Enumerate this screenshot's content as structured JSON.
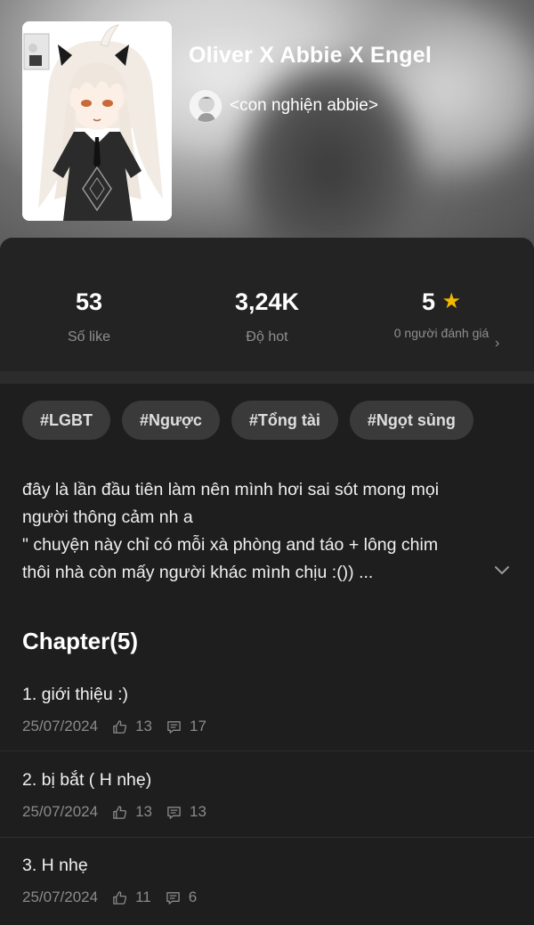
{
  "story": {
    "title": "Oliver X Abbie X Engel",
    "author": "<con nghiện abbie>"
  },
  "stats": {
    "likes_value": "53",
    "likes_label": "Số like",
    "hot_value": "3,24K",
    "hot_label": "Độ hot",
    "rating_value": "5",
    "rating_label": "0 người đánh giá"
  },
  "tags": [
    "#LGBT",
    "#Ngược",
    "#Tổng tài",
    "#Ngọt sủng"
  ],
  "description": {
    "lines": [
      "đây là lần đầu tiên làm nên mình hơi sai sót mong mọi",
      "người thông cảm nh a",
      "\" chuyện này chỉ có mỗi xà phòng and táo + lông chim",
      "thôi nhà còn mấy người khác mình chịu :()) ..."
    ]
  },
  "chapters": {
    "heading": "Chapter(5)",
    "items": [
      {
        "title": "1. giới thiệu :)",
        "date": "25/07/2024",
        "likes": "13",
        "comments": "17"
      },
      {
        "title": "2. bị bắt ( H nhẹ)",
        "date": "25/07/2024",
        "likes": "13",
        "comments": "13"
      },
      {
        "title": "3. H nhẹ",
        "date": "25/07/2024",
        "likes": "11",
        "comments": "6"
      }
    ]
  },
  "colors": {
    "background": "#1e1e1e",
    "stats_bg": "#232323",
    "tag_bg": "#3a3a3a",
    "muted_text": "#8a8a8a",
    "star": "#f5b800"
  },
  "icons": {
    "rating": "star-icon",
    "more": "chevron-right-icon",
    "expand": "chevron-down-icon",
    "likes": "thumbs-up-icon",
    "comments": "comment-icon"
  }
}
